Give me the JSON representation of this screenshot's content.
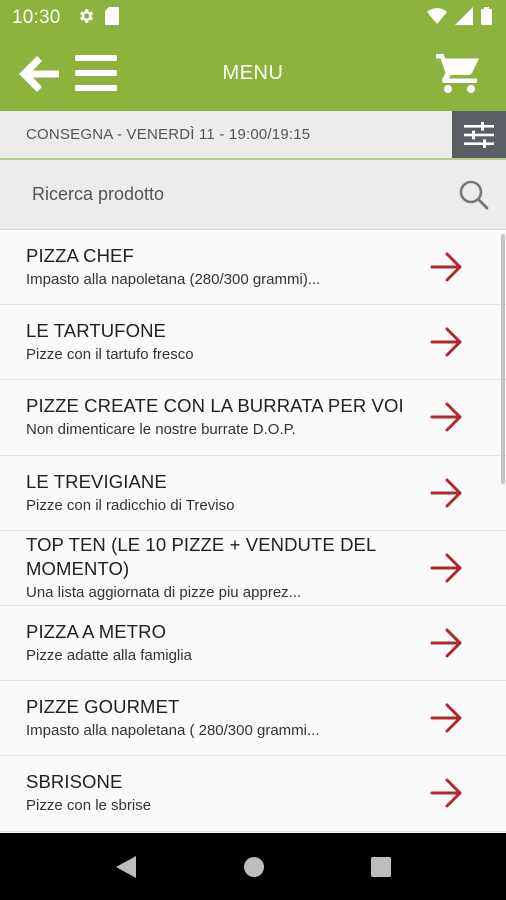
{
  "status_bar": {
    "time": "10:30",
    "icons": [
      "settings-icon",
      "sd-card-icon",
      "wifi-icon",
      "signal-icon",
      "battery-icon"
    ]
  },
  "app_bar": {
    "title": "MENU",
    "background": "#8bb33e"
  },
  "delivery": {
    "text": "CONSEGNA - VENERDÌ 11 - 19:00/19:15"
  },
  "search": {
    "placeholder": "Ricerca prodotto"
  },
  "accent_color": "#b0272e",
  "items": [
    {
      "title": "PIZZA CHEF",
      "subtitle": "Impasto alla napoletana (280/300 grammi)..."
    },
    {
      "title": "LE TARTUFONE",
      "subtitle": "Pizze con il tartufo fresco"
    },
    {
      "title": "PIZZE CREATE CON LA BURRATA PER VOI",
      "subtitle": "Non dimenticare le nostre burrate D.O.P."
    },
    {
      "title": "LE TREVIGIANE",
      "subtitle": "Pizze con il radicchio di Treviso"
    },
    {
      "title": "TOP TEN (LE 10 PIZZE + VENDUTE DEL MOMENTO)",
      "subtitle": "Una lista aggiornata di pizze piu apprez..."
    },
    {
      "title": "PIZZA A METRO",
      "subtitle": "Pizze adatte alla famiglia"
    },
    {
      "title": "PIZZE GOURMET",
      "subtitle": "Impasto alla napoletana ( 280/300 grammi..."
    },
    {
      "title": "SBRISONE",
      "subtitle": "Pizze con le sbrise"
    }
  ]
}
